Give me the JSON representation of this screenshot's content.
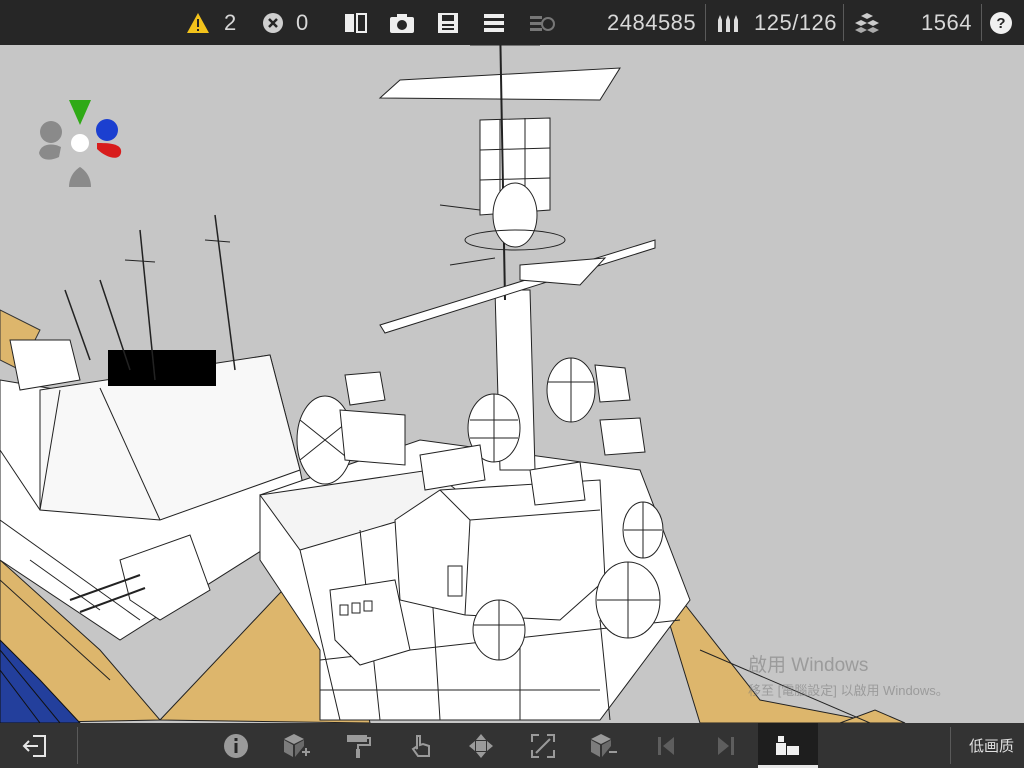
{
  "topbar": {
    "warnings_count": "2",
    "errors_count": "0",
    "polygon_count": "2484585",
    "ammo_count": "125/126",
    "parts_count": "1564",
    "icons": [
      "warning-icon",
      "error-icon",
      "split-view-icon",
      "camera-icon",
      "save-icon",
      "menu-icon",
      "ammo-icon",
      "parts-icon",
      "help-icon"
    ]
  },
  "bottombar": {
    "quality_label": "低画质",
    "icons": [
      "exit-icon",
      "info-icon",
      "cube-add-icon",
      "paint-roller-icon",
      "hand-pointer-icon",
      "move-icon",
      "resize-icon",
      "cube-remove-icon",
      "prev-icon",
      "next-icon",
      "parts-stack-icon"
    ]
  },
  "watermark": {
    "line1": "啟用 Windows",
    "line2": "移至 [電腦設定] 以啟用 Windows。"
  },
  "colors": {
    "bar": "#262626",
    "viewport": "#c6c6c6",
    "deck": "#ddb66c",
    "gizmo_x": "#d81c1c",
    "gizmo_y": "#2faa16",
    "gizmo_z": "#1b3fd0"
  }
}
